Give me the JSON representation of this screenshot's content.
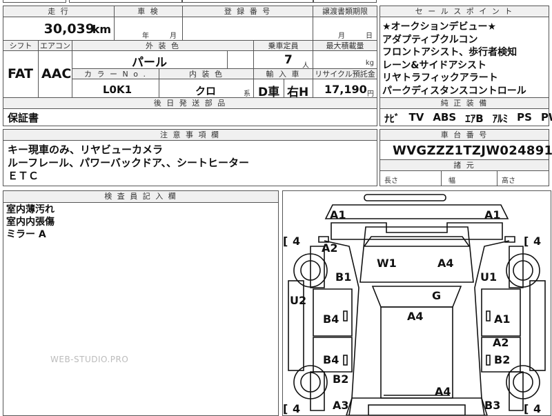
{
  "top_row": {
    "mileage_header": "走 行",
    "mileage_value": "30,039",
    "mileage_unit": "km",
    "inspection_header": "車 検",
    "inspection_year_label": "年",
    "inspection_month_label": "月",
    "registration_header": "登 録 番 号",
    "transfer_header": "譲渡書類期限",
    "transfer_month_label": "月",
    "transfer_day_label": "日"
  },
  "sales_points": {
    "header": "セ ー ル ス ポ イ ン ト",
    "lines": [
      "★オークションデビュー★",
      "アダプティブクルコン",
      "フロントアシスト、歩行者検知",
      "レーン&サイドアシスト",
      "リヤトラフィックアラート",
      "パークディスタンスコントロール"
    ]
  },
  "specs": {
    "shift_header": "シフト",
    "shift_value": "FAT",
    "aircon_header": "エアコン",
    "aircon_value": "AAC",
    "exterior_header": "外 装 色",
    "exterior_value": "パール",
    "capacity_header": "乗車定員",
    "capacity_value": "7",
    "capacity_unit": "人",
    "maxload_header": "最大積載量",
    "maxload_unit": "kg",
    "colorno_header": "カ ラ ー N o .",
    "colorno_value": "L0K1",
    "interior_header": "内 装 色",
    "interior_value": "クロ",
    "interior_suffix": "系",
    "import_header": "輸 入 車",
    "import_value1": "D車",
    "import_value2": "右H",
    "recycle_header": "リサイクル預託金",
    "recycle_value": "17,190",
    "recycle_unit": "円"
  },
  "later_parts": {
    "header": "後 日 発 送 部 品",
    "value": "保証書"
  },
  "equipment": {
    "header": "純 正 装 備",
    "items": [
      "ﾅﾋﾞ",
      "TV",
      "ABS",
      "ｴｱB",
      "ｱﾙﾐ",
      "PS",
      "PW"
    ]
  },
  "notes": {
    "header": "注 意 事 項 欄",
    "lines": [
      "キー現車のみ、リヤビューカメラ",
      "ルーフレール、パワーバックドア、、シートヒーター",
      "ＥＴＣ"
    ]
  },
  "chassis": {
    "header": "車 台 番 号",
    "value": "WVGZZZ1TZJW024891"
  },
  "dimensions": {
    "header": "諸 元",
    "length_label": "長さ",
    "width_label": "幅",
    "height_label": "高さ"
  },
  "inspector": {
    "header": "検 査 員 記 入 欄",
    "lines": [
      "室内薄汚れ",
      "室内内張傷",
      "ミラー A"
    ]
  },
  "watermark": "WEB-STUDIO.PRO",
  "diagram": {
    "tire_fl": "4",
    "tire_fr": "4",
    "tire_rl": "4",
    "tire_rr": "4",
    "marks": {
      "a1_left": "A1",
      "a1_right": "A1",
      "a2_left": "A2",
      "b1_left": "B1",
      "w1": "W1",
      "a4_hood": "A4",
      "u1": "U1",
      "u2": "U2",
      "g": "G",
      "b4_left_front": "B4",
      "a4_roof": "A4",
      "a1_right_door": "A1",
      "a2_right": "A2",
      "b4_left_rear": "B4",
      "b2_right": "B2",
      "b2_left": "B2",
      "a4_rear": "A4",
      "a3": "A3",
      "b3": "B3"
    }
  }
}
